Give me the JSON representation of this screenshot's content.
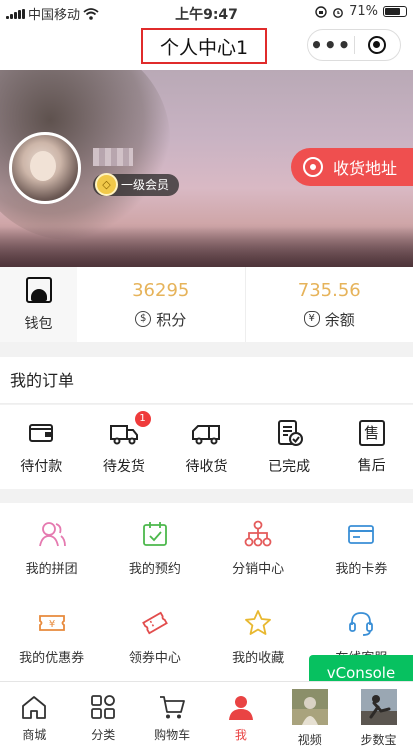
{
  "status": {
    "carrier": "中国移动",
    "time": "上午9:47",
    "battery": "71%"
  },
  "navbar": {
    "title": "个人中心1",
    "more_icon": "more-dots-icon",
    "close_icon": "target-close-icon"
  },
  "profile": {
    "level": "一级会员",
    "address_button": "收货地址"
  },
  "wallet": {
    "label": "钱包",
    "points_value": "36295",
    "points_label": "积分",
    "balance_value": "735.56",
    "balance_label": "余额"
  },
  "orders": {
    "title": "我的订单",
    "items": [
      {
        "label": "待付款",
        "icon": "wallet-icon"
      },
      {
        "label": "待发货",
        "icon": "truck-icon",
        "badge": "1"
      },
      {
        "label": "待收货",
        "icon": "delivery-truck-icon"
      },
      {
        "label": "已完成",
        "icon": "checklist-icon"
      },
      {
        "label": "售后",
        "icon": "after-sale-icon"
      }
    ]
  },
  "services": [
    {
      "label": "我的拼团",
      "icon": "group-buy-icon",
      "color": "#e57ab0"
    },
    {
      "label": "我的预约",
      "icon": "calendar-check-icon",
      "color": "#4cb84c"
    },
    {
      "label": "分销中心",
      "icon": "distribution-icon",
      "color": "#e45b5b"
    },
    {
      "label": "我的卡券",
      "icon": "card-icon",
      "color": "#3a8fd6"
    },
    {
      "label": "我的优惠券",
      "icon": "coupon-icon",
      "color": "#e88a3c"
    },
    {
      "label": "领券中心",
      "icon": "ticket-icon",
      "color": "#e24d4d"
    },
    {
      "label": "我的收藏",
      "icon": "star-icon",
      "color": "#e8b830"
    },
    {
      "label": "在线客服",
      "icon": "headset-icon",
      "color": "#3a8fd6"
    }
  ],
  "vconsole": "vConsole",
  "tabs": [
    {
      "label": "商城",
      "icon": "home-icon"
    },
    {
      "label": "分类",
      "icon": "category-icon"
    },
    {
      "label": "购物车",
      "icon": "cart-icon"
    },
    {
      "label": "我",
      "icon": "person-icon",
      "active": true
    },
    {
      "label": "视频",
      "icon": "video-thumb"
    },
    {
      "label": "步数宝",
      "icon": "steps-thumb"
    }
  ],
  "colors": {
    "accent": "#ef4f4f",
    "value": "#e6b35a",
    "active_tab": "#e94343",
    "vconsole": "#07c160"
  }
}
